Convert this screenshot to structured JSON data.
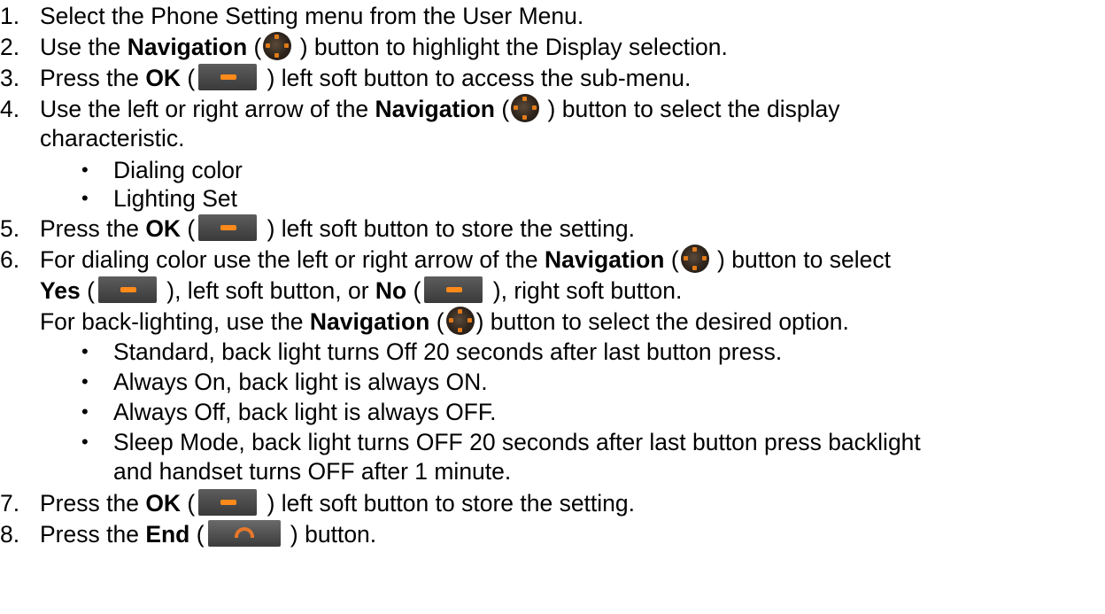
{
  "steps": {
    "s1": {
      "num": "1.",
      "text": "Select the Phone Setting menu from the User Menu."
    },
    "s2": {
      "num": "2.",
      "pre": "Use the ",
      "bold": "Navigation",
      "open": " (",
      "close": " ) button to highlight the Display selection."
    },
    "s3": {
      "num": "3.",
      "pre": "Press the ",
      "bold": "OK",
      "open": " (",
      "close": " ) left soft button to access the sub-menu."
    },
    "s4": {
      "num": "4.",
      "pre": "Use the left or right arrow of the ",
      "bold": "Navigation",
      "open": " (",
      "close": " ) button to select the display",
      "cont": "characteristic."
    },
    "s4_bullets": [
      "Dialing color",
      "Lighting Set"
    ],
    "s5": {
      "num": "5.",
      "pre": "Press the ",
      "bold": "OK",
      "open": " (",
      "close": " ) left soft button to store the setting."
    },
    "s6": {
      "num": "6.",
      "pre": "For dialing color use the left or right arrow of the ",
      "bold": "Navigation",
      "open": " (",
      "close": " ) button to select",
      "l2_bold1": "Yes",
      "l2_open1": " (",
      "l2_mid": " ), left soft button, or ",
      "l2_bold2": "No",
      "l2_open2": " (",
      "l2_end": " ), right soft button.",
      "l3_pre": "For back-lighting, use the ",
      "l3_bold": "Navigation",
      "l3_open": " (",
      "l3_close": ") button to select the desired option."
    },
    "s6_bullets": [
      "Standard, back light turns Off 20 seconds after last button press.",
      "Always On, back light is always ON.",
      "Always Off, back light is always OFF.",
      "Sleep Mode, back light turns OFF 20 seconds after last button press backlight"
    ],
    "s6_bullet_cont": "and handset turns OFF after 1 minute.",
    "s7": {
      "num": "7.",
      "pre": "Press the ",
      "bold": "OK",
      "open": " (",
      "close": " ) left soft button to store the setting."
    },
    "s8": {
      "num": "8.",
      "pre": "Press the ",
      "bold": "End",
      "open": " (",
      "close": " ) button."
    }
  },
  "bullet_glyph": "•",
  "icons": {
    "navigation": "navigation-button-icon",
    "soft": "soft-button-icon",
    "end": "end-call-button-icon"
  },
  "colors": {
    "icon_accent": "#ff8a1a",
    "icon_body": "#3a3a3a"
  }
}
